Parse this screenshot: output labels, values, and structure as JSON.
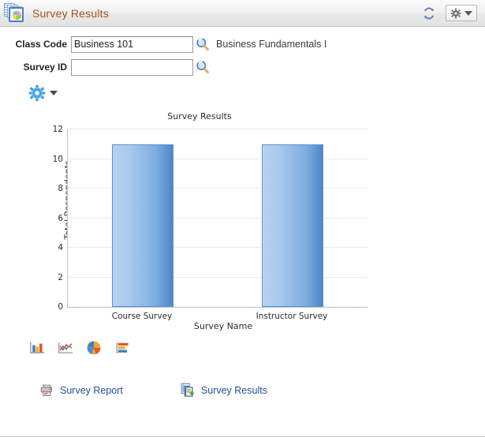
{
  "header": {
    "title": "Survey Results",
    "icon": "survey-results-stack-icon",
    "refresh_icon": "refresh-icon",
    "gear_icon": "gear-icon",
    "caret_icon": "chevron-down-icon",
    "title_color": "#a3531d"
  },
  "fields": [
    {
      "label": "Class Code",
      "value": "Business 101",
      "placeholder": "",
      "lookup_icon": "magnifier-icon",
      "description": "Business Fundamentals I"
    },
    {
      "label": "Survey ID",
      "value": "",
      "placeholder": "",
      "lookup_icon": "magnifier-icon",
      "description": ""
    }
  ],
  "chart_toolbar": {
    "gear_icon": "gear-icon",
    "caret_icon": "chevron-down-icon"
  },
  "chart_data": {
    "type": "bar",
    "title": "Survey Results",
    "xlabel": "Survey Name",
    "ylabel": "Total Respondents",
    "categories": [
      "Course Survey",
      "Instructor Survey"
    ],
    "values": [
      11,
      11
    ],
    "ylim": [
      0,
      12
    ],
    "yticks": [
      0,
      2,
      4,
      6,
      8,
      10,
      12
    ],
    "grid": true,
    "legend": false,
    "bar_color": "#7eaee0",
    "bar_border_color": "#5e92cd"
  },
  "chart_types": [
    {
      "name": "vertical-bar-chart-icon",
      "label": "Bar Chart"
    },
    {
      "name": "line-chart-icon",
      "label": "Line Chart"
    },
    {
      "name": "pie-chart-icon",
      "label": "Pie Chart"
    },
    {
      "name": "horizontal-bar-chart-icon",
      "label": "Horizontal Bar Chart"
    }
  ],
  "links": [
    {
      "label": "Survey Report",
      "icon": "printer-icon"
    },
    {
      "label": "Survey Results",
      "icon": "pages-icon"
    }
  ]
}
